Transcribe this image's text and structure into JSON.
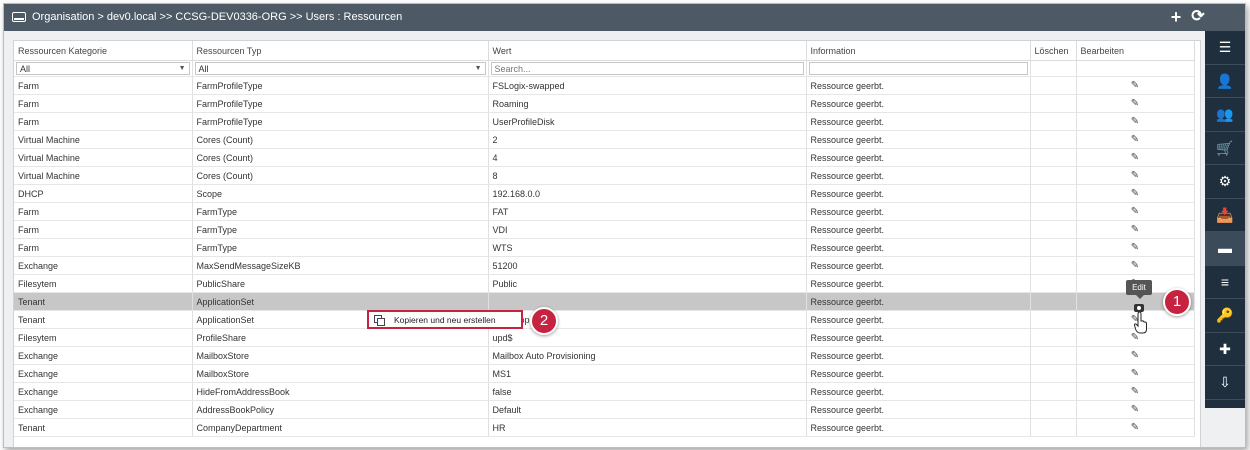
{
  "header": {
    "breadcrumb": "Organisation > dev0.local >> CCSG-DEV0336-ORG >> Users : Ressourcen",
    "add_label": "+",
    "refresh_label": "⟳"
  },
  "table": {
    "columns": [
      "Ressourcen Kategorie",
      "Ressourcen Typ",
      "Wert",
      "Information",
      "Löschen",
      "Bearbeiten"
    ],
    "filters": {
      "kategorie": "All",
      "typ": "All",
      "wert_placeholder": "Search..."
    },
    "rows": [
      {
        "kategorie": "Farm",
        "typ": "FarmProfileType",
        "wert": "FSLogix-swapped",
        "info": "Ressource geerbt."
      },
      {
        "kategorie": "Farm",
        "typ": "FarmProfileType",
        "wert": "Roaming",
        "info": "Ressource geerbt."
      },
      {
        "kategorie": "Farm",
        "typ": "FarmProfileType",
        "wert": "UserProfileDisk",
        "info": "Ressource geerbt."
      },
      {
        "kategorie": "Virtual Machine",
        "typ": "Cores (Count)",
        "wert": "2",
        "info": "Ressource geerbt."
      },
      {
        "kategorie": "Virtual Machine",
        "typ": "Cores (Count)",
        "wert": "4",
        "info": "Ressource geerbt."
      },
      {
        "kategorie": "Virtual Machine",
        "typ": "Cores (Count)",
        "wert": "8",
        "info": "Ressource geerbt."
      },
      {
        "kategorie": "DHCP",
        "typ": "Scope",
        "wert": "192.168.0.0",
        "info": "Ressource geerbt."
      },
      {
        "kategorie": "Farm",
        "typ": "FarmType",
        "wert": "FAT",
        "info": "Ressource geerbt."
      },
      {
        "kategorie": "Farm",
        "typ": "FarmType",
        "wert": "VDI",
        "info": "Ressource geerbt."
      },
      {
        "kategorie": "Farm",
        "typ": "FarmType",
        "wert": "WTS",
        "info": "Ressource geerbt."
      },
      {
        "kategorie": "Exchange",
        "typ": "MaxSendMessageSizeKB",
        "wert": "51200",
        "info": "Ressource geerbt."
      },
      {
        "kategorie": "Filesytem",
        "typ": "PublicShare",
        "wert": "Public",
        "info": "Ressource geerbt."
      },
      {
        "kategorie": "Tenant",
        "typ": "ApplicationSet",
        "wert": "",
        "info": "Ressource geerbt.",
        "selected": true
      },
      {
        "kategorie": "Tenant",
        "typ": "ApplicationSet",
        "wert": "Prep App",
        "info": "Ressource geerbt."
      },
      {
        "kategorie": "Filesytem",
        "typ": "ProfileShare",
        "wert": "upd$",
        "info": "Ressource geerbt."
      },
      {
        "kategorie": "Exchange",
        "typ": "MailboxStore",
        "wert": "Mailbox Auto Provisioning",
        "info": "Ressource geerbt."
      },
      {
        "kategorie": "Exchange",
        "typ": "MailboxStore",
        "wert": "MS1",
        "info": "Ressource geerbt."
      },
      {
        "kategorie": "Exchange",
        "typ": "HideFromAddressBook",
        "wert": "false",
        "info": "Ressource geerbt."
      },
      {
        "kategorie": "Exchange",
        "typ": "AddressBookPolicy",
        "wert": "Default",
        "info": "Ressource geerbt."
      },
      {
        "kategorie": "Tenant",
        "typ": "CompanyDepartment",
        "wert": "HR",
        "info": "Ressource geerbt."
      }
    ]
  },
  "sidebar": {
    "items": [
      {
        "name": "list-icon",
        "glyph": "☰"
      },
      {
        "name": "user-icon",
        "glyph": "👤"
      },
      {
        "name": "user-secret-icon",
        "glyph": "👥"
      },
      {
        "name": "cart-icon",
        "glyph": "🛒"
      },
      {
        "name": "gear-icon",
        "glyph": "⚙"
      },
      {
        "name": "inbox-icon",
        "glyph": "📥"
      },
      {
        "name": "hdd-icon",
        "glyph": "▬",
        "active": true
      },
      {
        "name": "list-ordered-icon",
        "glyph": "≡"
      },
      {
        "name": "key-icon",
        "glyph": "🔑"
      },
      {
        "name": "puzzle-icon",
        "glyph": "✚"
      },
      {
        "name": "tray-icon",
        "glyph": "⇩"
      }
    ]
  },
  "tooltip": {
    "text": "Edit"
  },
  "context_menu": {
    "label": "Kopieren und neu erstellen"
  },
  "badges": [
    {
      "text": "1"
    },
    {
      "text": "2"
    }
  ],
  "colors": {
    "accent": "#c5233f",
    "topbar": "#4d5a66",
    "sidebar": "#1f2f3d"
  }
}
